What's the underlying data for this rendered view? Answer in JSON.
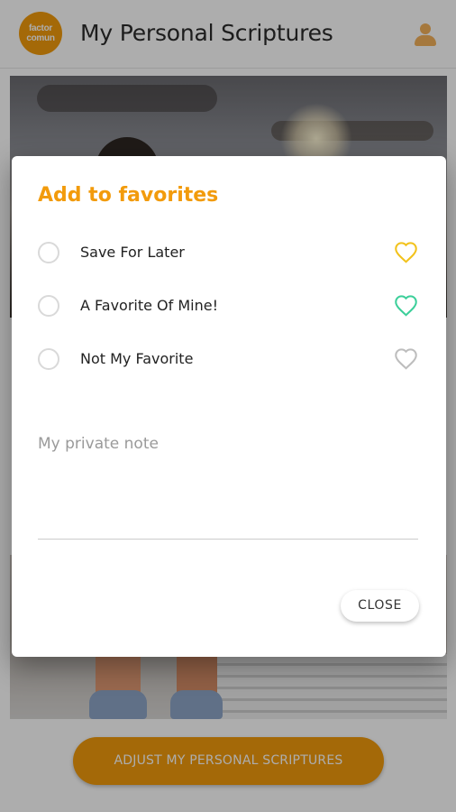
{
  "app_bar": {
    "logo_line1": "factor",
    "logo_line2": "comun",
    "title": "My Personal Scriptures",
    "profile_icon": "user-icon"
  },
  "background": {
    "adjust_button_label": "ADJUST MY PERSONAL SCRIPTURES"
  },
  "dialog": {
    "title": "Add to favorites",
    "options": [
      {
        "label": "Save For Later",
        "icon": "heart-outline-icon",
        "color": "#f2c21b"
      },
      {
        "label": "A Favorite Of Mine!",
        "icon": "heart-outline-icon",
        "color": "#3ccf9a"
      },
      {
        "label": "Not My Favorite",
        "icon": "heart-outline-icon",
        "color": "#bdbdbd"
      }
    ],
    "note_placeholder": "My private note",
    "close_label": "CLOSE"
  },
  "colors": {
    "accent": "#f29b0c"
  }
}
